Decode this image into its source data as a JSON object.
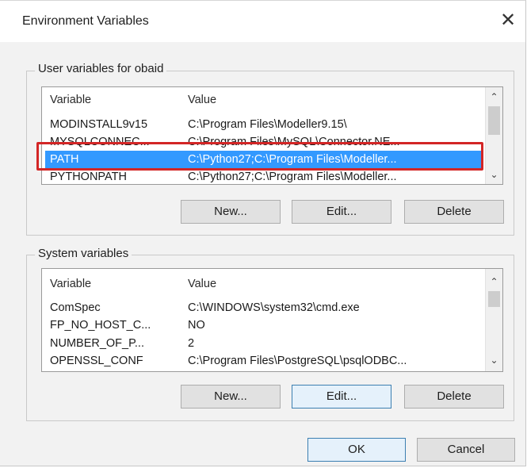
{
  "window": {
    "title": "Environment Variables",
    "close_glyph": "✕"
  },
  "user_vars": {
    "legend": "User variables for obaid",
    "header": {
      "name": "Variable",
      "value": "Value"
    },
    "rows": [
      {
        "name": "MODINSTALL9v15",
        "value": "C:\\Program Files\\Modeller9.15\\"
      },
      {
        "name": "MYSQLCONNEC...",
        "value": "C:\\Program Files\\MySQL\\Connector.NE..."
      },
      {
        "name": "PATH",
        "value": "C:\\Python27;C:\\Program Files\\Modeller..."
      },
      {
        "name": "PYTHONPATH",
        "value": "C:\\Python27;C:\\Program Files\\Modeller..."
      }
    ],
    "selected_row": "PATH",
    "buttons": {
      "new": "New...",
      "edit": "Edit...",
      "delete": "Delete"
    }
  },
  "system_vars": {
    "legend": "System variables",
    "header": {
      "name": "Variable",
      "value": "Value"
    },
    "rows": [
      {
        "name": "ComSpec",
        "value": "C:\\WINDOWS\\system32\\cmd.exe"
      },
      {
        "name": "FP_NO_HOST_C...",
        "value": "NO"
      },
      {
        "name": "NUMBER_OF_P...",
        "value": "2"
      },
      {
        "name": "OPENSSL_CONF",
        "value": "C:\\Program Files\\PostgreSQL\\psqlODBC..."
      }
    ],
    "buttons": {
      "new": "New...",
      "edit": "Edit...",
      "delete": "Delete"
    }
  },
  "footer": {
    "ok": "OK",
    "cancel": "Cancel"
  },
  "scroll": {
    "up_glyph": "⌃",
    "down_glyph": "⌄"
  },
  "colors": {
    "selection": "#3399ff",
    "annotation": "#d32626"
  }
}
